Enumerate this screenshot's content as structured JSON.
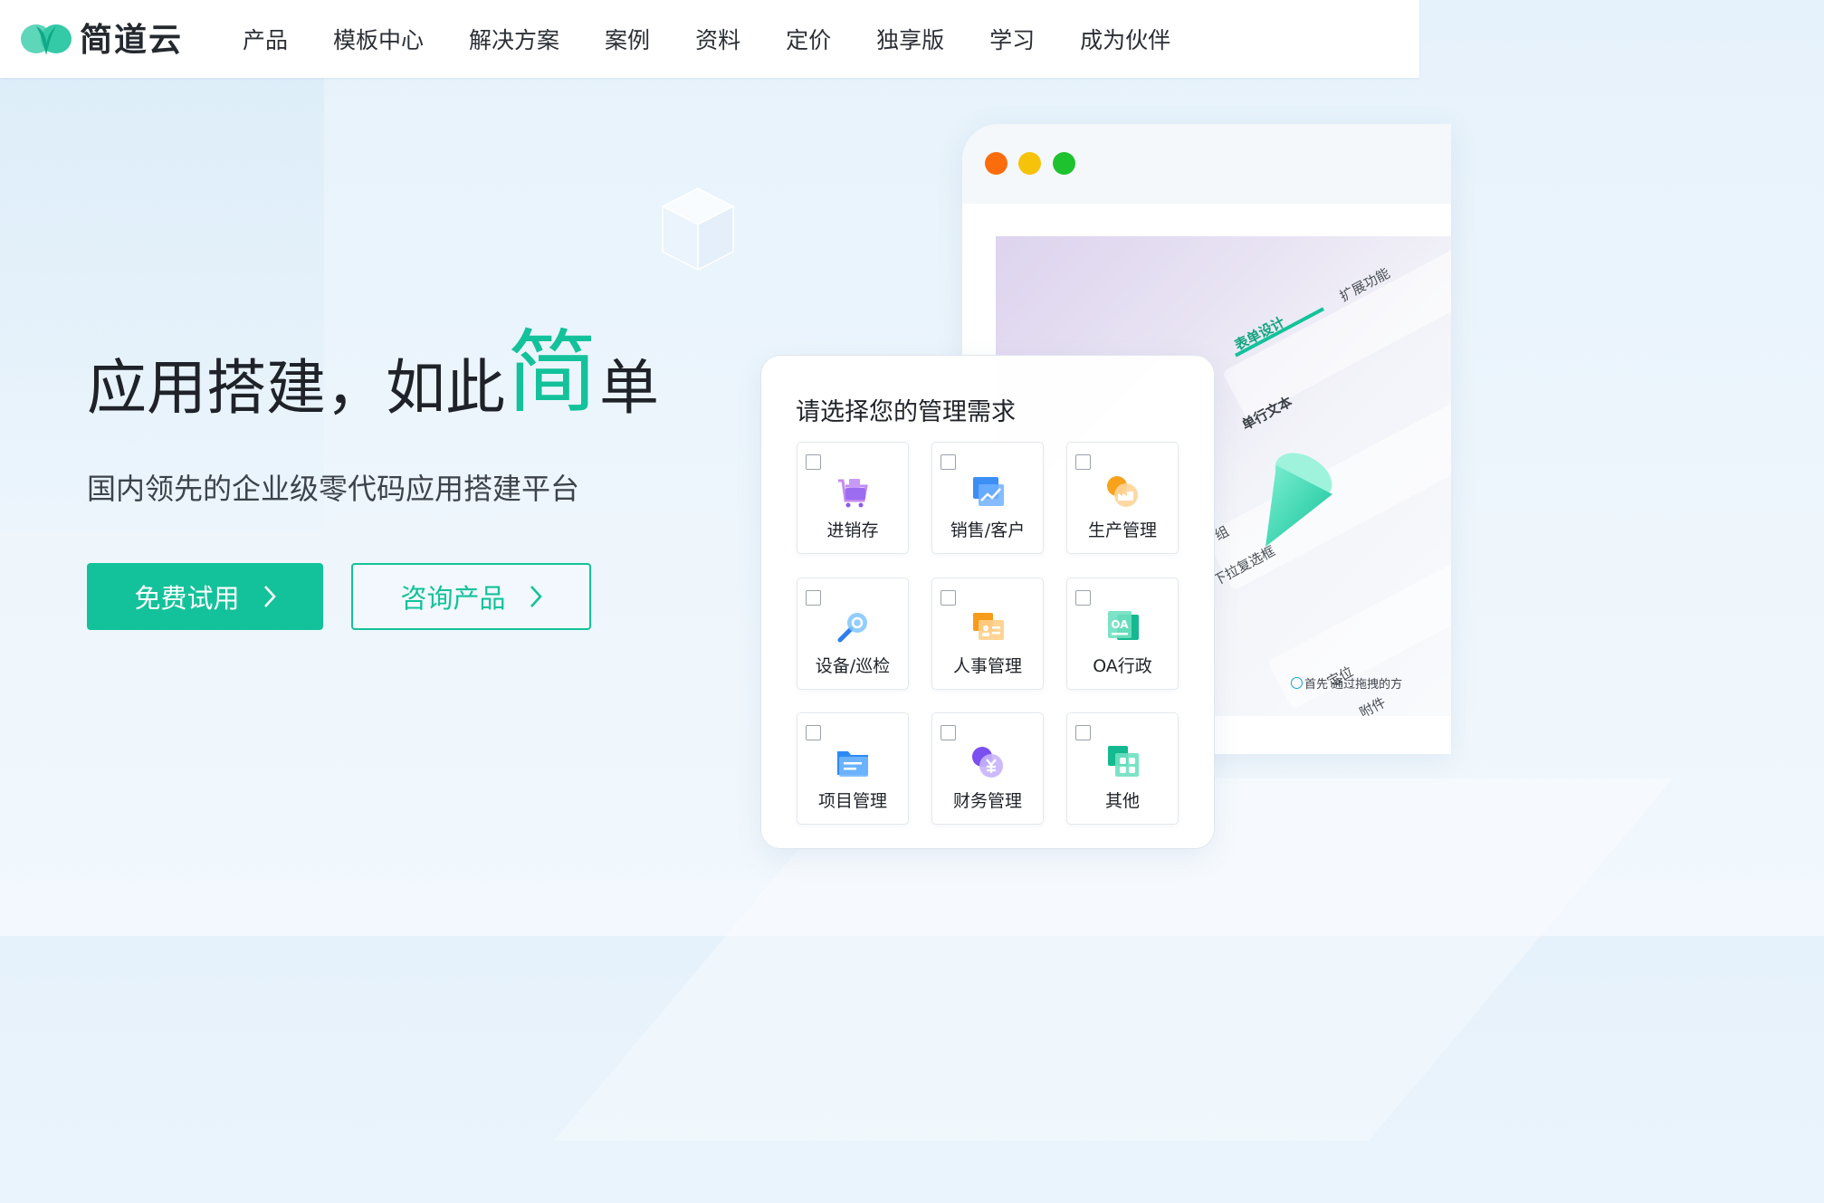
{
  "header": {
    "logo_text": "简道云",
    "nav": [
      "产品",
      "模板中心",
      "解决方案",
      "案例",
      "资料",
      "定价",
      "独享版",
      "学习",
      "成为伙伴"
    ]
  },
  "hero": {
    "title_before": "应用搭建，如此",
    "title_accent": "简",
    "title_after": "单",
    "subtitle": "国内领先的企业级零代码应用搭建平台",
    "primary_button": "免费试用",
    "secondary_button": "咨询产品"
  },
  "browser": {
    "dots": [
      "#fb6d0c",
      "#f6c20a",
      "#1ec22f"
    ],
    "tabs": [
      "表单设计",
      "扩展功能"
    ],
    "fields": [
      "单行文本",
      "组",
      "下拉复选框",
      "定位",
      "附件"
    ],
    "hint": "首先 通过拖拽的方"
  },
  "card": {
    "title": "请选择您的管理需求",
    "options": [
      {
        "label": "进销存",
        "icon": "shopping-cart-icon"
      },
      {
        "label": "销售/客户",
        "icon": "sales-chart-icon"
      },
      {
        "label": "生产管理",
        "icon": "factory-icon"
      },
      {
        "label": "设备/巡检",
        "icon": "inspection-magnifier-icon"
      },
      {
        "label": "人事管理",
        "icon": "id-card-icon"
      },
      {
        "label": "OA行政",
        "icon": "oa-document-icon"
      },
      {
        "label": "项目管理",
        "icon": "project-folder-icon"
      },
      {
        "label": "财务管理",
        "icon": "finance-yuan-icon"
      },
      {
        "label": "其他",
        "icon": "other-apps-icon"
      }
    ]
  },
  "colors": {
    "brand": "#13c29a",
    "text": "#1f2329"
  }
}
